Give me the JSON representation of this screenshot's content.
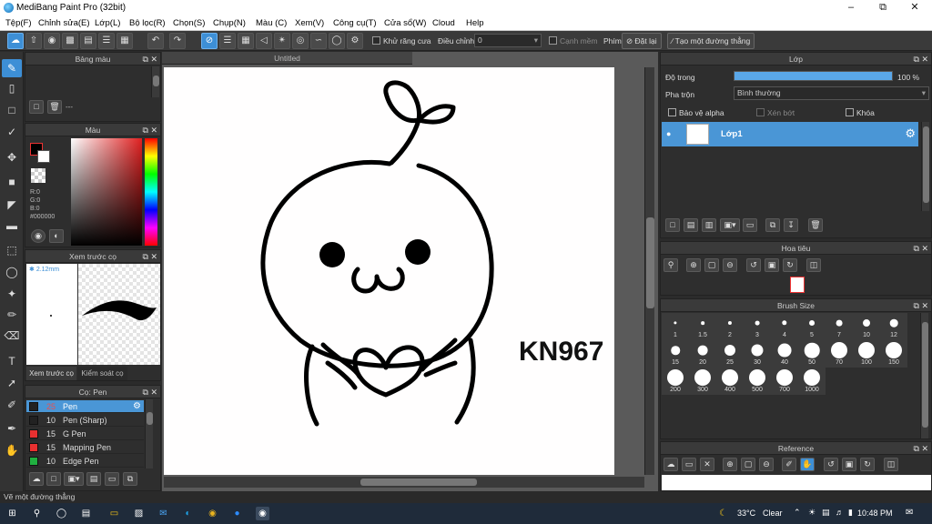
{
  "window": {
    "title": "MediBang Paint Pro (32bit)"
  },
  "menu": [
    "Tệp(F)",
    "Chỉnh sửa(E)",
    "Lớp(L)",
    "Bộ lọc(R)",
    "Chọn(S)",
    "Chụp(N)",
    "Màu (C)",
    "Xem(V)",
    "Công cụ(T)",
    "Cửa sổ(W)",
    "Cloud",
    "Help"
  ],
  "toolbar": {
    "antialias_label": "Khử răng cưa",
    "correction_label": "Điều chỉnh",
    "correction_value": "0",
    "soft_edge_label": "Cạnh mềm",
    "key_label": "Phím",
    "reset_label": "Đặt lại",
    "straight_line_label": "Tạo một đường thẳng"
  },
  "panels": {
    "palette": {
      "title": "Bảng màu",
      "page_text": "---"
    },
    "color": {
      "title": "Màu",
      "r": "R:0",
      "g": "G:0",
      "b": "B:0",
      "hex": "#000000",
      "fg": "#000000",
      "bg": "#ffffff"
    },
    "preview": {
      "title": "Xem trước cọ",
      "size": "2.12mm",
      "tab1": "Xem trước cọ",
      "tab2": "Kiểm soát cọ"
    },
    "brush": {
      "title": "Cọ: Pen",
      "items": [
        {
          "size": "25",
          "name": "Pen",
          "color": "#222222",
          "selected": true
        },
        {
          "size": "10",
          "name": "Pen (Sharp)",
          "color": "#222222",
          "selected": false
        },
        {
          "size": "15",
          "name": "G Pen",
          "color": "#e83030",
          "selected": false
        },
        {
          "size": "15",
          "name": "Mapping Pen",
          "color": "#e83030",
          "selected": false
        },
        {
          "size": "10",
          "name": "Edge Pen",
          "color": "#20b040",
          "selected": false
        }
      ]
    },
    "layer": {
      "title": "Lớp",
      "opacity_label": "Độ trong",
      "opacity_value": "100 %",
      "opacity_fraction": 1.0,
      "blend_label": "Pha trộn",
      "blend_value": "Bình thường",
      "protect_alpha": "Bảo vệ alpha",
      "clip": "Xén bớt",
      "lock": "Khóa",
      "layer_name": "Lớp1"
    },
    "navigator": {
      "title": "Hoa tiêu"
    },
    "brush_size": {
      "title": "Brush Size",
      "sizes": [
        "1",
        "1.5",
        "2",
        "3",
        "4",
        "5",
        "7",
        "10",
        "12",
        "15",
        "20",
        "25",
        "30",
        "40",
        "50",
        "70",
        "100",
        "150",
        "200",
        "300",
        "400",
        "500",
        "700",
        "1000"
      ]
    },
    "reference": {
      "title": "Reference"
    }
  },
  "canvas": {
    "tab": "Untitled",
    "signature": "KN967"
  },
  "status": {
    "text": "Vẽ một đường thẳng"
  },
  "taskbar": {
    "weather": "33°C",
    "weather_desc": "Clear",
    "time": "10:48 PM"
  }
}
